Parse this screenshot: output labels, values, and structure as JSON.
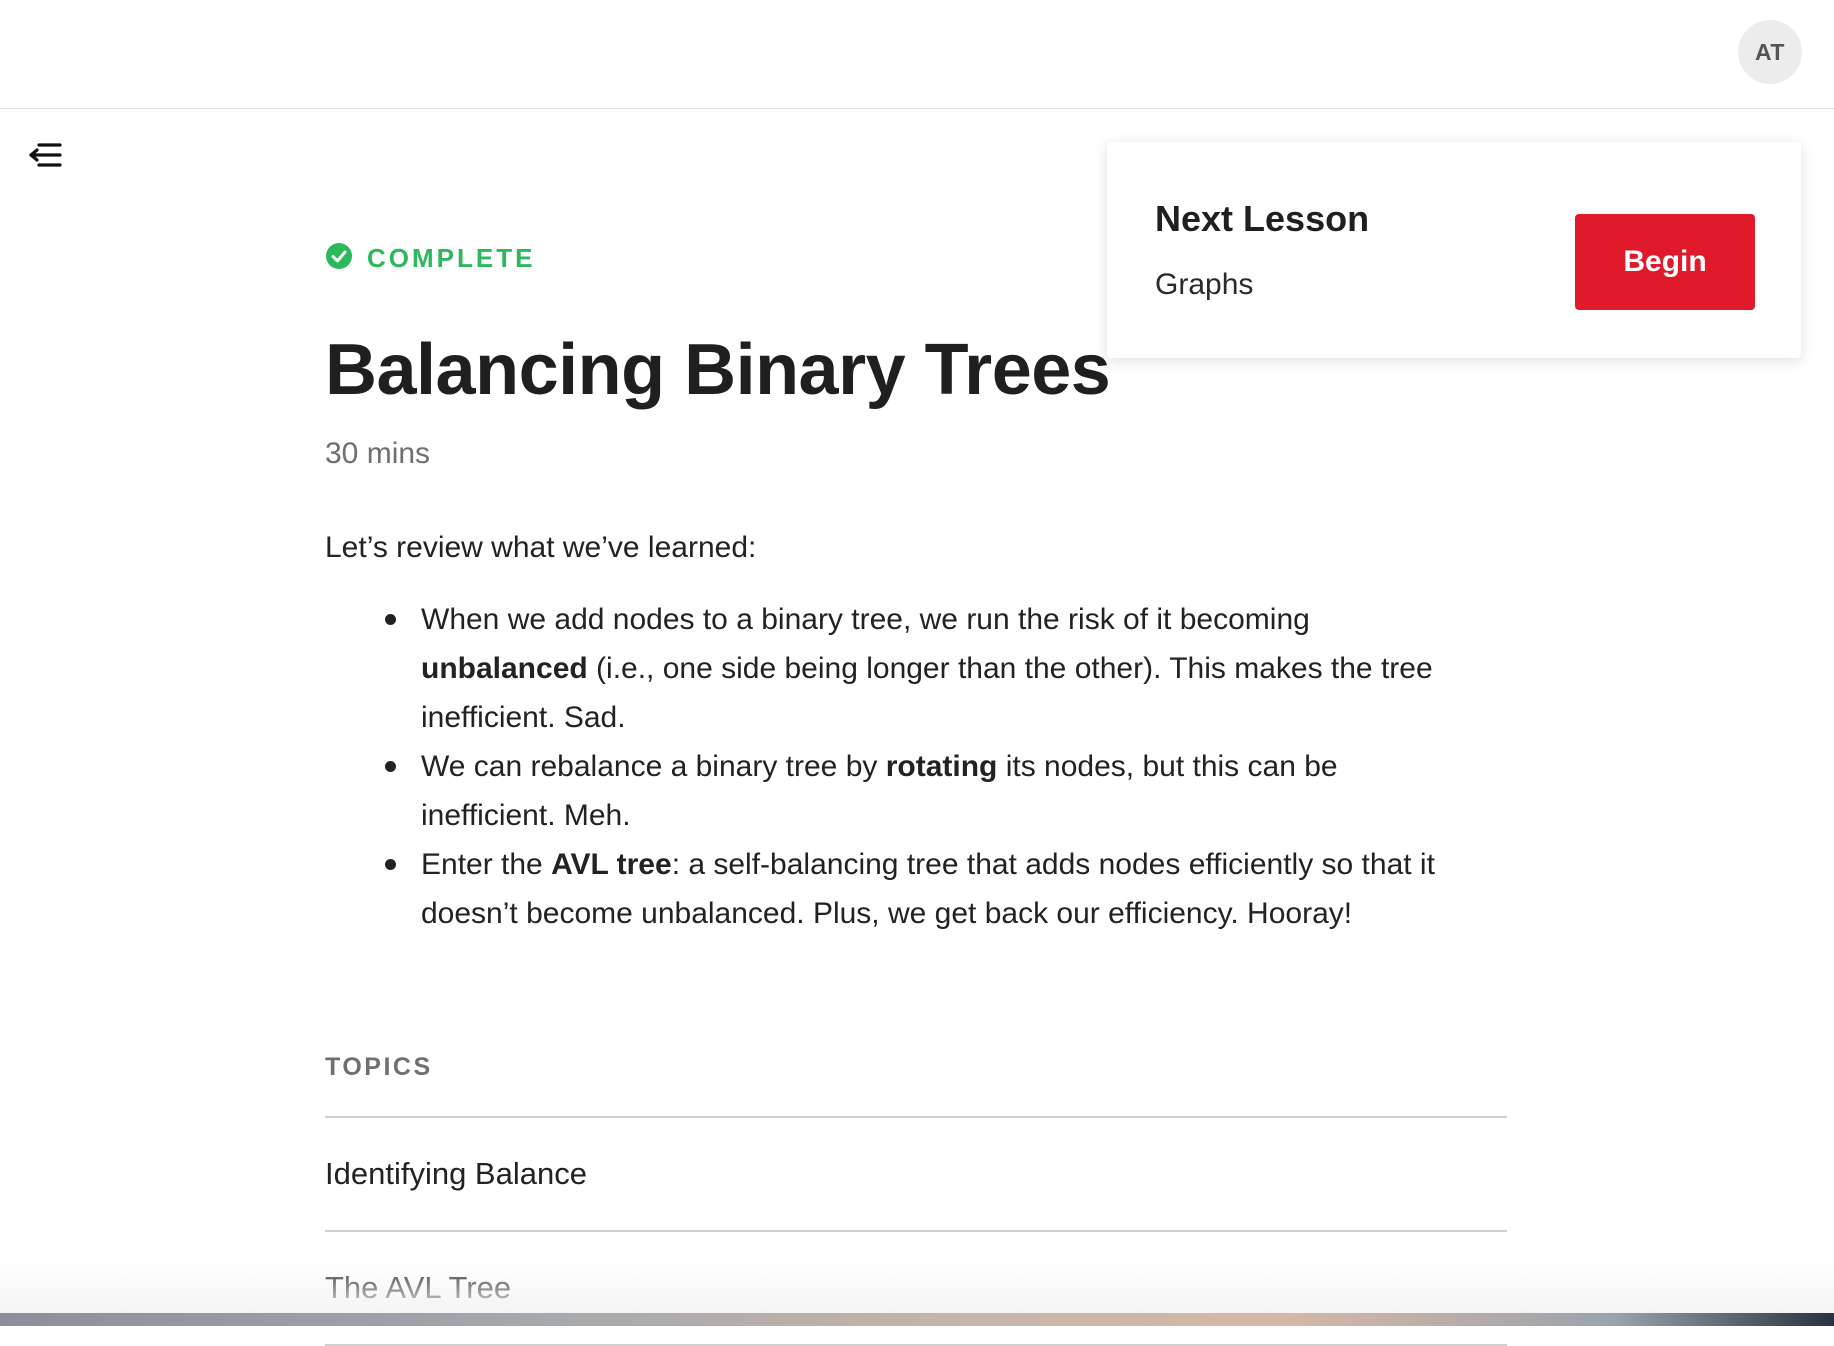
{
  "header": {
    "avatar_initials": "AT"
  },
  "icons": {
    "menu": "menu-collapse-icon",
    "status": "check-circle-icon"
  },
  "lesson": {
    "status": "COMPLETE",
    "title": "Balancing Binary Trees",
    "duration": "30 mins",
    "intro": "Let’s review what we’ve learned:",
    "bullets": [
      {
        "before": "When we add nodes to a binary tree, we run the risk of it becoming ",
        "bold": "unbalanced",
        "after": " (i.e., one side being longer than the other). This makes the tree inefficient. Sad."
      },
      {
        "before": "We can rebalance a binary tree by ",
        "bold": "rotating",
        "after": " its nodes, but this can be inefficient. Meh."
      },
      {
        "before": "Enter the ",
        "bold": "AVL tree",
        "after": ": a self-balancing tree that adds nodes efficiently so that it doesn’t become unbalanced. Plus, we get back our efficiency. Hooray!"
      }
    ]
  },
  "topics": {
    "heading": "TOPICS",
    "items": [
      "Identifying Balance",
      "The AVL Tree"
    ]
  },
  "next_lesson": {
    "heading": "Next Lesson",
    "name": "Graphs",
    "button_label": "Begin"
  },
  "colors": {
    "accent_red": "#e01a2b",
    "complete_green": "#2eb85c",
    "text_dark": "#222222",
    "text_muted": "#6f6f6f"
  }
}
